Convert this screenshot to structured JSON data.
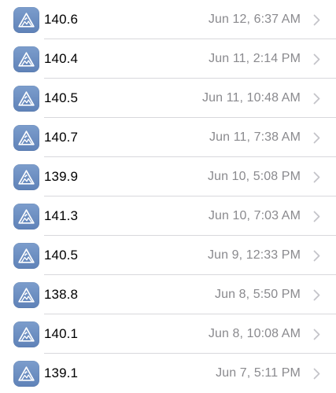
{
  "colors": {
    "icon_background": "#6a8cc2",
    "value_text": "#000000",
    "date_text": "#8a8a8e",
    "chevron": "#c4c4c9",
    "separator": "#d8d8dc"
  },
  "icons": {
    "row_icon": "mountain-app-icon",
    "disclosure": "chevron-right-icon"
  },
  "entries": [
    {
      "value": "140.6",
      "datetime": "Jun 12, 6:37 AM"
    },
    {
      "value": "140.4",
      "datetime": "Jun 11, 2:14 PM"
    },
    {
      "value": "140.5",
      "datetime": "Jun 11, 10:48 AM"
    },
    {
      "value": "140.7",
      "datetime": "Jun 11, 7:38 AM"
    },
    {
      "value": "139.9",
      "datetime": "Jun 10, 5:08 PM"
    },
    {
      "value": "141.3",
      "datetime": "Jun 10, 7:03 AM"
    },
    {
      "value": "140.5",
      "datetime": "Jun 9, 12:33 PM"
    },
    {
      "value": "138.8",
      "datetime": "Jun 8, 5:50 PM"
    },
    {
      "value": "140.1",
      "datetime": "Jun 8, 10:08 AM"
    },
    {
      "value": "139.1",
      "datetime": "Jun 7, 5:11 PM"
    }
  ]
}
